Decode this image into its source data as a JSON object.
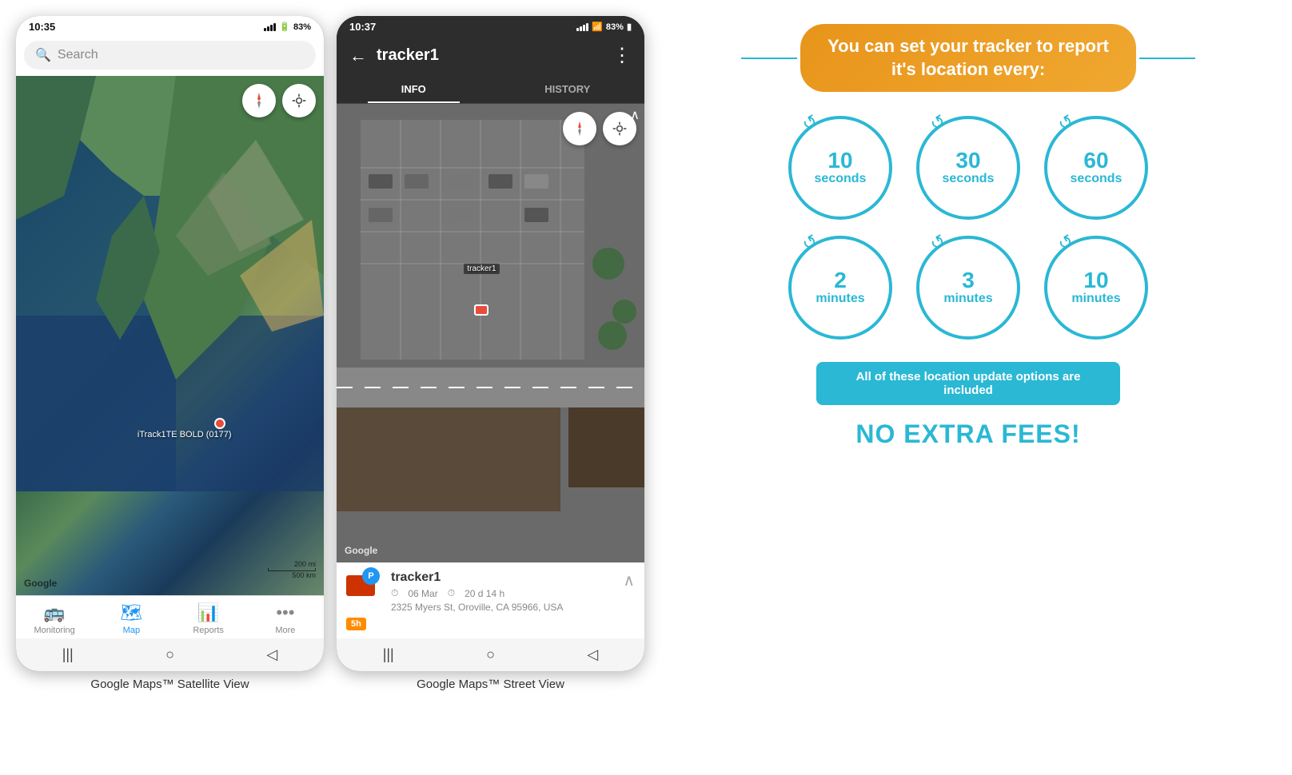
{
  "phones": {
    "phone1": {
      "status_bar": {
        "time": "10:35",
        "signal": "▲▲▲ .ill",
        "battery": "83%"
      },
      "search": {
        "placeholder": "Search"
      },
      "map": {
        "google_label": "Google",
        "scale_200mi": "200 mi",
        "scale_500km": "500 km",
        "tracker_label": "iTrack1TE BOLD (0177)"
      },
      "nav": {
        "items": [
          {
            "label": "Monitoring",
            "icon": "🚌",
            "active": false
          },
          {
            "label": "Map",
            "icon": "📍",
            "active": true
          },
          {
            "label": "Reports",
            "icon": "📊",
            "active": false
          },
          {
            "label": "More",
            "icon": "···",
            "active": false
          }
        ]
      },
      "caption": "Google Maps™ Satellite View"
    },
    "phone2": {
      "status_bar": {
        "time": "10:37",
        "signal": "▲▲▲ .ill",
        "battery": "83%"
      },
      "header": {
        "back": "←",
        "title": "tracker1",
        "menu": "⋮"
      },
      "tabs": [
        {
          "label": "INFO",
          "active": true
        },
        {
          "label": "HISTORY",
          "active": false
        }
      ],
      "tracker_info": {
        "name": "tracker1",
        "date": "06 Mar",
        "duration": "20 d 14 h",
        "address": "2325 Myers St, Oroville, CA 95966, USA",
        "badge": "5h"
      },
      "map": {
        "google_label": "Google",
        "tracker1_label": "tracker1"
      },
      "caption": "Google Maps™ Street View"
    }
  },
  "infographic": {
    "headline": "You can set your tracker to report it's location every:",
    "circles": [
      {
        "number": "10",
        "unit": "seconds"
      },
      {
        "number": "30",
        "unit": "seconds"
      },
      {
        "number": "60",
        "unit": "seconds"
      },
      {
        "number": "2",
        "unit": "minutes"
      },
      {
        "number": "3",
        "unit": "minutes"
      },
      {
        "number": "10",
        "unit": "minutes"
      }
    ],
    "included_text": "All of these location update options are included",
    "no_fees_text": "NO EXTRA FEES!",
    "accent_color": "#2ab8d4",
    "orange_color": "#e8941a"
  }
}
